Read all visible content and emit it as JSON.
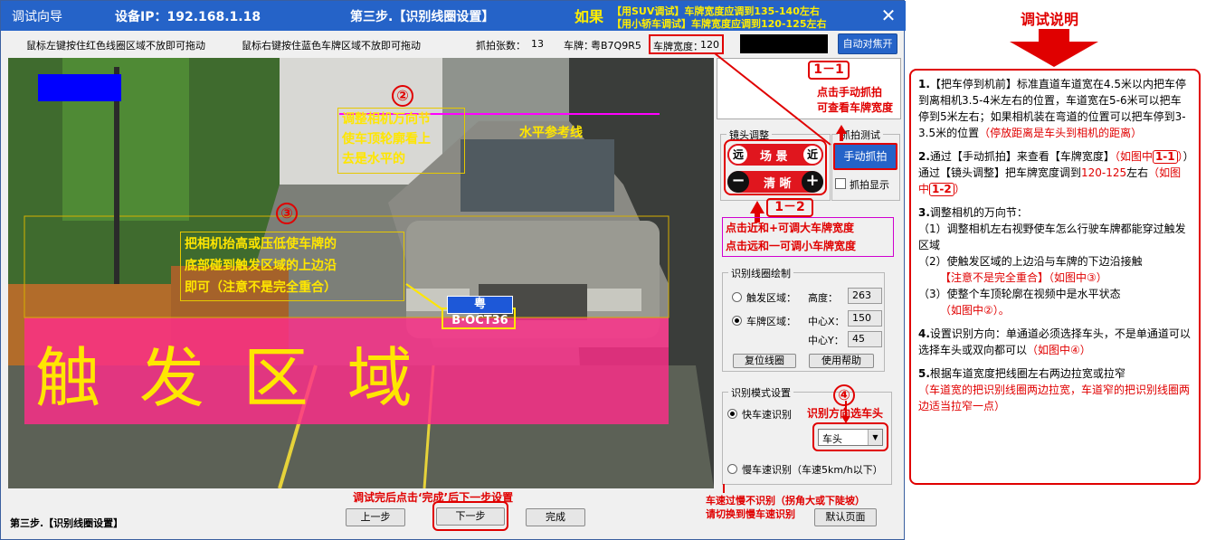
{
  "titlebar": {
    "app_title": "调试向导",
    "device_ip": "设备IP：192.168.1.18",
    "step_title": "第三步.【识别线圈设置】",
    "close_label": "✕"
  },
  "if_prefix": "如果",
  "if_lines": [
    "【用SUV调试】车牌宽度应调到135-140左右",
    "【用小轿车调试】车牌宽度应调到120-125左右"
  ],
  "toolbar": {
    "left_drag_hint": "鼠标左键按住红色线圈区域不放即可拖动",
    "right_drag_hint": "鼠标右键按住蓝色车牌区域不放即可拖动",
    "capture_count_label": "抓拍张数：",
    "capture_count": "13",
    "plate_label": "车牌：",
    "plate_value": "粤B7Q9R5",
    "plate_width_label": "车牌宽度：",
    "plate_width_value": "120",
    "auto_focus_label": "自动对焦开"
  },
  "video": {
    "trigger_text": "触 发 区 域",
    "plate_text": "粤B·OCT36",
    "horizon_label": "水平参考线",
    "note2": [
      "调整相机万向节",
      "使车顶轮廓看上",
      "去是水平的"
    ],
    "note3": [
      "把相机抬高或压低使车牌的",
      "底部碰到触发区域的上边沿",
      "即可（注意不是完全重合）"
    ],
    "circle2": "②",
    "circle3": "③"
  },
  "lens": {
    "group_label": "镜头调整",
    "far": "远",
    "scene": "场 景",
    "near": "近",
    "minus": "−",
    "clear": "清 晰",
    "plus": "+"
  },
  "capture_test": {
    "group_label": "抓拍测试",
    "manual_button": "手动抓拍",
    "display_label": "抓拍显示"
  },
  "coil": {
    "group_label": "识别线圈绘制",
    "trigger_area": "触发区域：",
    "height_label": "高度：",
    "height_value": "263",
    "plate_area": "车牌区域：",
    "cx_label": "中心X：",
    "cx_value": "150",
    "cy_label": "中心Y：",
    "cy_value": "45",
    "reset_button": "复位线圈",
    "help_button": "使用帮助"
  },
  "mode": {
    "group_label": "识别模式设置",
    "fast": "快车速识别",
    "direction_value": "车头",
    "slow": "慢车速识别（车速5km/h以下）"
  },
  "annotations": {
    "a11": "1－1",
    "a11_text": [
      "点击手动抓拍",
      "可查看车牌宽度"
    ],
    "a12": "1－2",
    "a12_text": [
      "点击近和+可调大车牌宽度",
      "点击远和一可调小车牌宽度"
    ],
    "a4": "④",
    "a4_text": "识别方向选车头",
    "finish_hint": "调试完后点击‘完成’后下一步设置",
    "slow_hint": [
      "车速过慢不识别（拐角大或下陡坡）",
      "请切换到慢车速识别"
    ]
  },
  "bottom": {
    "status": "第三步.【识别线圈设置】",
    "prev": "上一步",
    "next": "下一步",
    "finish": "完成",
    "default_page": "默认页面"
  },
  "guide": {
    "title": "调试说明",
    "p1_num": "1.",
    "p1": "【把车停到机前】标准直道车道宽在4.5米以内把车停到离相机3.5-4米左右的位置，车道宽在5-6米可以把车停到5米左右；如果相机装在弯道的位置可以把车停到3-3.5米的位置",
    "p1_red": "（停放距离是车头到相机的距离）",
    "p2_num": "2.",
    "p2a": "通过【手动抓拍】来查看【车牌宽度】",
    "p2b": "（如图中",
    "p2_box1": "1-1",
    "p2c": "）通过【镜头调整】把车牌宽度调到",
    "p2_range": "120-125",
    "p2d": "左右",
    "p2e": "（如图中",
    "p2_box2": "1-2",
    "p2f": "）",
    "p3_num": "3.",
    "p3": "调整相机的万向节：",
    "p3_1": "（1）调整相机左右视野使车怎么行驶车牌都能穿过触发区域",
    "p3_2a": "（2）使触发区域的上边沿与车牌的下边沿接触",
    "p3_2b": "【注意不是完全重合】（如图中③）",
    "p3_3a": "（3）使整个车顶轮廓在视频中是水平状态",
    "p3_3b": "（如图中②）。",
    "p4_num": "4.",
    "p4": "设置识别方向：单通道必须选择车头，不是单通道可以选择车头或双向都可以",
    "p4_red": "（如图中④）",
    "p5_num": "5.",
    "p5": "根据车道宽度把线圈左右两边拉宽或拉窄",
    "p5_red": "（车道宽的把识别线圈两边拉宽，车道窄的把识别线圈两边适当拉窄一点）"
  }
}
